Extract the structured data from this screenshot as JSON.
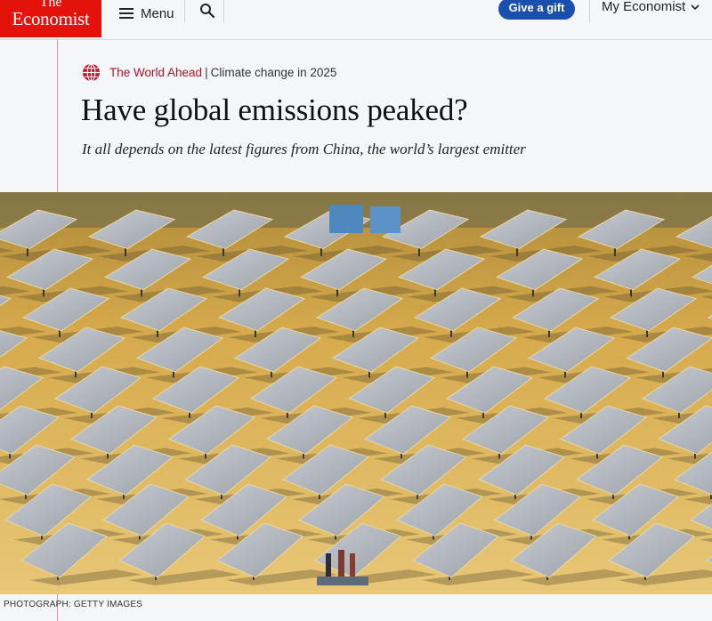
{
  "nav": {
    "logo_line1": "The",
    "logo_line2": "Economist",
    "menu_label": "Menu",
    "menu_icon": "hamburger-icon",
    "search_icon": "search-icon",
    "gift_label": "Give a gift",
    "account_label": "My Economist",
    "account_icon": "chevron-down-icon"
  },
  "article": {
    "rubric_icon": "globe-icon",
    "section": "The World Ahead",
    "divider": "|",
    "topic": "Climate change in 2025",
    "headline": "Have global emissions peaked?",
    "subheadline": "It all depends on the latest figures from China, the world’s largest emitter",
    "photo_credit": "PHOTOGRAPH: GETTY IMAGES"
  },
  "colors": {
    "brand_red": "#e3120b",
    "gift_blue": "#1a4fad",
    "section_red": "#b0122e"
  }
}
